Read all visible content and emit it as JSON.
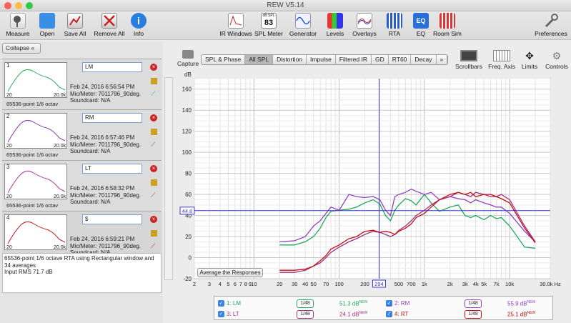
{
  "window": {
    "title": "REW V5.14"
  },
  "toolbar": {
    "measure": "Measure",
    "open": "Open",
    "save_all": "Save All",
    "remove_all": "Remove All",
    "info": "Info",
    "ir_windows": "IR Windows",
    "spl_meter": "SPL Meter",
    "spl_meter_value": "83",
    "spl_meter_unit": "dB SPL",
    "generator": "Generator",
    "levels": "Levels",
    "overlays": "Overlays",
    "rta": "RTA",
    "eq": "EQ",
    "room_sim": "Room Sim",
    "preferences": "Preferences"
  },
  "left": {
    "collapse": "Collapse",
    "measurements": [
      {
        "num": "1",
        "name": "LM",
        "date": "Feb 24, 2016 6:56:54 PM",
        "mic": "Mic/Meter: 7011796_90deg.",
        "soundcard": "Soundcard: N/A",
        "label": "65536-point 1/6 octav",
        "x_start": "20",
        "x_end": "20.0k",
        "color": "#2fb05a"
      },
      {
        "num": "2",
        "name": "RM",
        "date": "Feb 24, 2016 6:57:46 PM",
        "mic": "Mic/Meter: 7011796_90deg.",
        "soundcard": "Soundcard: N/A",
        "label": "65536-point 1/6 octav",
        "x_start": "20",
        "x_end": "20.0k",
        "color": "#8e3db0"
      },
      {
        "num": "3",
        "name": "LT",
        "date": "Feb 24, 2016 6:58:32 PM",
        "mic": "Mic/Meter: 7011796_90deg.",
        "soundcard": "Soundcard: N/A",
        "label": "65536-point 1/6 octav",
        "x_start": "20",
        "x_end": "20.0k",
        "color": "#b03aa0"
      },
      {
        "num": "4",
        "name": "$",
        "date": "Feb 24, 2016 6:59:21 PM",
        "mic": "Mic/Meter: 7011796_90deg.",
        "soundcard": "Soundcard: N/A",
        "label": "",
        "x_start": "20",
        "x_end": "20.0k",
        "color": "#c02020"
      }
    ],
    "description": "65536-point 1/6 octave RTA using Rectangular window and 34 averages\nInput RMS 71.7 dB"
  },
  "graph": {
    "capture": "Capture",
    "tabs": [
      "SPL & Phase",
      "All SPL",
      "Distortion",
      "Impulse",
      "Filtered IR",
      "GD",
      "RT60",
      "Decay",
      "»"
    ],
    "active_tab": "All SPL",
    "scrollbars": "Scrollbars",
    "freq_axis": "Freq. Axis",
    "limits": "Limits",
    "controls": "Controls",
    "avg_button": "Average the Responses",
    "cursor_db": "44.6",
    "cursor_freq": "294"
  },
  "chart_data": {
    "type": "line",
    "ylabel": "dB",
    "xunit": "Hz",
    "x_scale": "log",
    "xlim": [
      2,
      30000
    ],
    "ylim": [
      -20,
      170
    ],
    "y_ticks": [
      "160",
      "140",
      "120",
      "100",
      "80",
      "60",
      "40",
      "20",
      "0",
      "-20"
    ],
    "x_ticks": [
      "2",
      "3",
      "4",
      "5",
      "6",
      "7",
      "8",
      "9",
      "10",
      "20",
      "30",
      "40",
      "50",
      "70",
      "100",
      "200",
      "500",
      "700",
      "1k",
      "2k",
      "3k",
      "4k",
      "5k",
      "7k",
      "10k",
      "30.0k Hz"
    ],
    "cursor": {
      "x": 294,
      "y": 44.6
    },
    "series": [
      {
        "name": "1: LM",
        "color": "#20a860",
        "x": [
          20,
          30,
          40,
          50,
          60,
          70,
          80,
          100,
          130,
          160,
          200,
          250,
          300,
          350,
          400,
          450,
          500,
          600,
          700,
          800,
          1000,
          1200,
          1500,
          2000,
          2500,
          3000,
          3500,
          4000,
          5000,
          6000,
          7000,
          8000,
          10000,
          15000,
          20000
        ],
        "y": [
          12,
          12,
          15,
          20,
          28,
          38,
          44,
          45,
          46,
          48,
          52,
          55,
          51,
          40,
          35,
          45,
          50,
          56,
          54,
          50,
          60,
          52,
          44,
          48,
          50,
          40,
          38,
          40,
          36,
          40,
          37,
          38,
          30,
          10,
          9
        ]
      },
      {
        "name": "2: RM",
        "color": "#9040c0",
        "x": [
          20,
          30,
          40,
          50,
          60,
          70,
          80,
          100,
          130,
          160,
          200,
          250,
          300,
          350,
          400,
          450,
          500,
          600,
          700,
          800,
          1000,
          1200,
          1500,
          2000,
          2500,
          3000,
          3500,
          4000,
          5000,
          6000,
          7000,
          8000,
          10000,
          15000,
          20000
        ],
        "y": [
          15,
          16,
          20,
          30,
          35,
          42,
          48,
          45,
          60,
          58,
          57,
          58,
          55,
          45,
          40,
          58,
          60,
          62,
          65,
          63,
          60,
          62,
          55,
          58,
          56,
          55,
          52,
          55,
          52,
          50,
          48,
          48,
          42,
          25,
          15
        ]
      },
      {
        "name": "3: LT",
        "color": "#a03080",
        "x": [
          20,
          30,
          40,
          50,
          60,
          70,
          80,
          100,
          130,
          160,
          200,
          250,
          300,
          350,
          400,
          450,
          500,
          600,
          700,
          800,
          1000,
          1200,
          1500,
          2000,
          2500,
          3000,
          3500,
          4000,
          5000,
          6000,
          7000,
          8000,
          10000,
          15000,
          20000
        ],
        "y": [
          -14,
          -14,
          -12,
          -8,
          -5,
          0,
          5,
          10,
          15,
          18,
          22,
          25,
          24,
          22,
          20,
          22,
          26,
          30,
          35,
          40,
          45,
          50,
          55,
          58,
          62,
          60,
          58,
          62,
          60,
          58,
          58,
          60,
          55,
          30,
          15
        ]
      },
      {
        "name": "4: RT",
        "color": "#c01010",
        "x": [
          20,
          30,
          40,
          50,
          60,
          70,
          80,
          100,
          130,
          160,
          200,
          250,
          300,
          350,
          400,
          450,
          500,
          600,
          700,
          800,
          1000,
          1200,
          1500,
          2000,
          2500,
          3000,
          3500,
          4000,
          5000,
          6000,
          7000,
          8000,
          10000,
          15000,
          20000
        ],
        "y": [
          -12,
          -12,
          -11,
          -8,
          -3,
          2,
          8,
          12,
          18,
          20,
          25,
          26,
          24,
          25,
          24,
          22,
          25,
          28,
          32,
          38,
          42,
          48,
          55,
          60,
          62,
          60,
          62,
          58,
          60,
          60,
          58,
          56,
          52,
          28,
          14
        ]
      }
    ]
  },
  "legend": [
    {
      "label": "1: LM",
      "oct": "1/48",
      "value": "51.3 dB",
      "sup": "NEW",
      "color": "#20a860"
    },
    {
      "label": "2: RM",
      "oct": "1/48",
      "value": "55.9 dB",
      "sup": "NEW",
      "color": "#9040c0"
    },
    {
      "label": "3: LT",
      "oct": "1/48",
      "value": "24.1 dB",
      "sup": "NEW",
      "color": "#a03080"
    },
    {
      "label": "4: RT",
      "oct": "1/48",
      "value": "25.1 dB",
      "sup": "NEW",
      "color": "#c01010"
    }
  ]
}
